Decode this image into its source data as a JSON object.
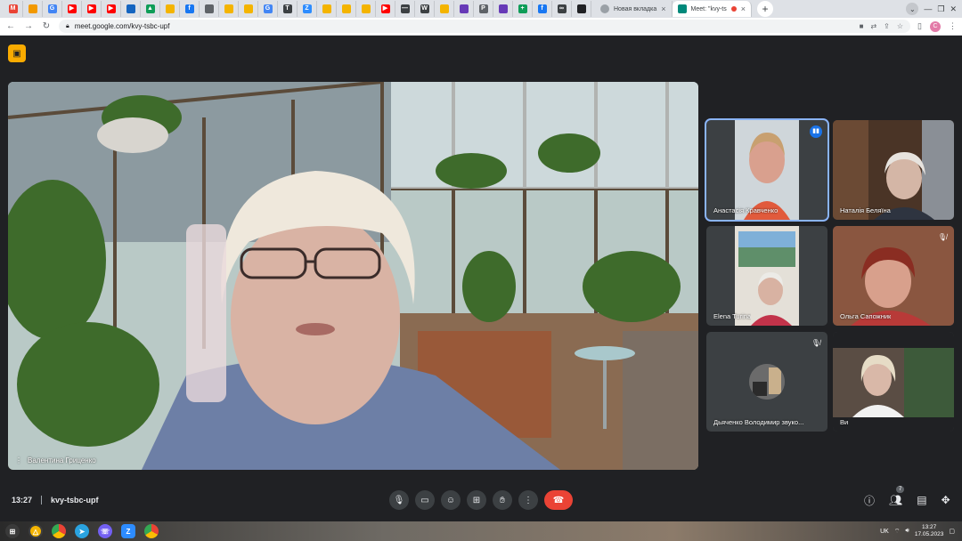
{
  "browser": {
    "tabs": [
      {
        "icon": "gmail-icon",
        "color": "#ea4335",
        "glyph": "M"
      },
      {
        "icon": "image-icon",
        "color": "#f29900",
        "glyph": ""
      },
      {
        "icon": "google-icon",
        "color": "#4285f4",
        "glyph": "G"
      },
      {
        "icon": "youtube-icon",
        "color": "#ff0000",
        "glyph": "▶"
      },
      {
        "icon": "youtube-icon",
        "color": "#ff0000",
        "glyph": "▶"
      },
      {
        "icon": "youtube-icon",
        "color": "#ff0000",
        "glyph": "▶"
      },
      {
        "icon": "flag-icon",
        "color": "#1565c0",
        "glyph": ""
      },
      {
        "icon": "drive-icon",
        "color": "#0f9d58",
        "glyph": "▲"
      },
      {
        "icon": "image-icon",
        "color": "#f4b400",
        "glyph": ""
      },
      {
        "icon": "facebook-icon",
        "color": "#1877f2",
        "glyph": "f"
      },
      {
        "icon": "globe-icon",
        "color": "#5f6368",
        "glyph": ""
      },
      {
        "icon": "image-icon",
        "color": "#f4b400",
        "glyph": ""
      },
      {
        "icon": "image-icon",
        "color": "#f4b400",
        "glyph": ""
      },
      {
        "icon": "google-icon",
        "color": "#4285f4",
        "glyph": "G"
      },
      {
        "icon": "text-icon",
        "color": "#3c4043",
        "glyph": "T"
      },
      {
        "icon": "zoom-icon",
        "color": "#2d8cff",
        "glyph": "Z"
      },
      {
        "icon": "image-icon",
        "color": "#f4b400",
        "glyph": ""
      },
      {
        "icon": "image-icon",
        "color": "#f4b400",
        "glyph": ""
      },
      {
        "icon": "image-icon",
        "color": "#f4b400",
        "glyph": ""
      },
      {
        "icon": "youtube-icon",
        "color": "#ff0000",
        "glyph": "▶"
      },
      {
        "icon": "dash-icon",
        "color": "#3c4043",
        "glyph": "—"
      },
      {
        "icon": "wikipedia-icon",
        "color": "#3c4043",
        "glyph": "W"
      },
      {
        "icon": "image-icon",
        "color": "#f4b400",
        "glyph": ""
      },
      {
        "icon": "doc-icon",
        "color": "#673ab7",
        "glyph": ""
      },
      {
        "icon": "pdf-icon",
        "color": "#5f6368",
        "glyph": "P"
      },
      {
        "icon": "doc-icon",
        "color": "#673ab7",
        "glyph": ""
      },
      {
        "icon": "sheets-icon",
        "color": "#0f9d58",
        "glyph": "+"
      },
      {
        "icon": "facebook-icon",
        "color": "#1877f2",
        "glyph": "f"
      },
      {
        "icon": "infinity-icon",
        "color": "#3c4043",
        "glyph": "∞"
      },
      {
        "icon": "github-icon",
        "color": "#202124",
        "glyph": ""
      }
    ],
    "newtab_label": "Новая вкладка",
    "active_tab_label": "Meet: \"kvy-ts",
    "url": "meet.google.com/kvy-tsbc-upf",
    "profile_initial": "C"
  },
  "meet": {
    "meeting_time": "13:27",
    "meeting_code": "kvy-tsbc-upf",
    "main_speaker": "Валентина Гриценко",
    "participants": [
      {
        "name": "Анастасія Кравченко",
        "speaking": true,
        "muted": false
      },
      {
        "name": "Наталія Беляїна",
        "speaking": false,
        "muted": false
      },
      {
        "name": "Elena Turina",
        "speaking": false,
        "muted": false
      },
      {
        "name": "Ольга Сапожник",
        "speaking": false,
        "muted": true
      },
      {
        "name": "Дьяченко Володимир звуко...",
        "speaking": false,
        "muted": true
      },
      {
        "name": "Ви",
        "speaking": false,
        "muted": false
      }
    ],
    "participants_count": "7"
  },
  "taskbar": {
    "lang": "UK",
    "time": "13:27",
    "date": "17.05.2023"
  }
}
